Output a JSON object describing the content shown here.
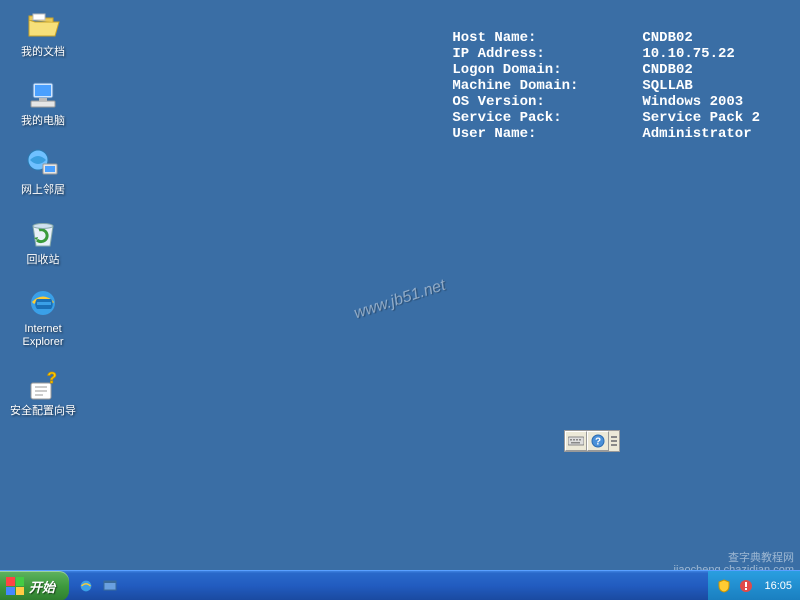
{
  "desktop": {
    "icons": [
      {
        "id": "my-documents",
        "label": "我的文档"
      },
      {
        "id": "my-computer",
        "label": "我的电脑"
      },
      {
        "id": "network-places",
        "label": "网上邻居"
      },
      {
        "id": "recycle-bin",
        "label": "回收站"
      },
      {
        "id": "internet-explorer",
        "label": "Internet\nExplorer"
      },
      {
        "id": "security-config-wizard",
        "label": "安全配置向导"
      }
    ]
  },
  "bginfo": {
    "rows": [
      {
        "label": "Host Name:",
        "value": "CNDB02"
      },
      {
        "label": "IP Address:",
        "value": "10.10.75.22"
      },
      {
        "label": "Logon Domain:",
        "value": "CNDB02"
      },
      {
        "label": "Machine Domain:",
        "value": "SQLLAB"
      },
      {
        "label": "OS Version:",
        "value": "Windows 2003"
      },
      {
        "label": "Service Pack:",
        "value": "Service Pack 2"
      },
      {
        "label": "User Name:",
        "value": "Administrator"
      }
    ]
  },
  "watermark": {
    "center": "www.jb51.net",
    "bottom1": "查字典教程网",
    "bottom2": "jiaocheng.chazidian.com"
  },
  "taskbar": {
    "start_label": "开始",
    "clock": "16:05"
  }
}
